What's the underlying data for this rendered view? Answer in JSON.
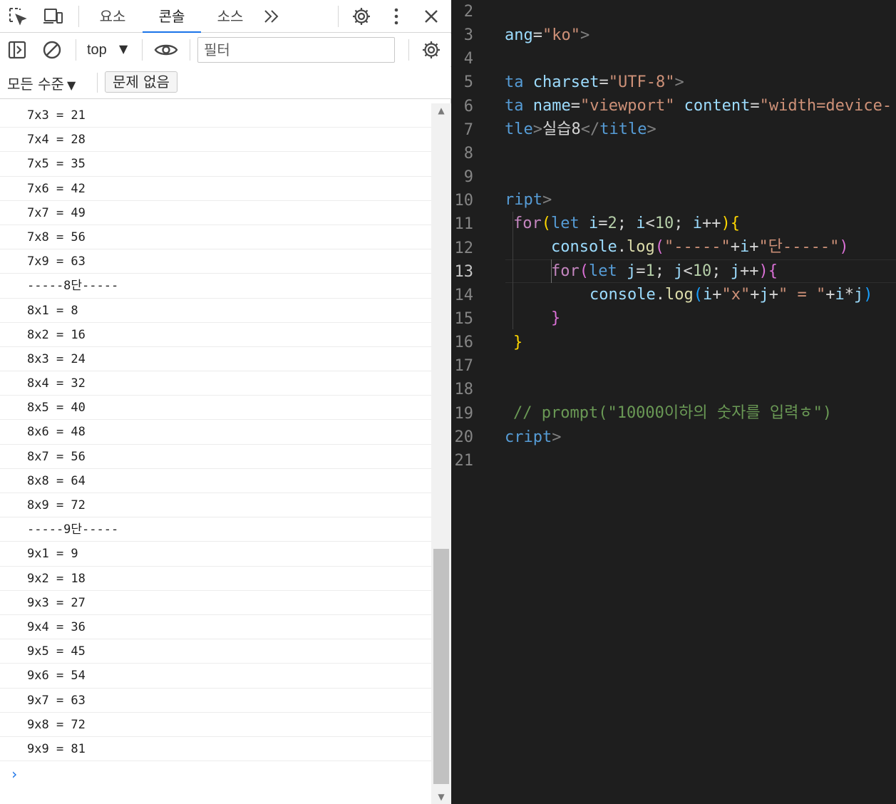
{
  "devtools": {
    "tabs": [
      {
        "label": "요소",
        "active": false
      },
      {
        "label": "콘솔",
        "active": true
      },
      {
        "label": "소스",
        "active": false
      }
    ],
    "toolbar": {
      "context": "top",
      "filter_placeholder": "필터"
    },
    "levels": {
      "label": "모든 수준",
      "issues": "문제 없음"
    },
    "console_lines": [
      "7x3 = 21",
      "7x4 = 28",
      "7x5 = 35",
      "7x6 = 42",
      "7x7 = 49",
      "7x8 = 56",
      "7x9 = 63",
      "-----8단-----",
      "8x1 = 8",
      "8x2 = 16",
      "8x3 = 24",
      "8x4 = 32",
      "8x5 = 40",
      "8x6 = 48",
      "8x7 = 56",
      "8x8 = 64",
      "8x9 = 72",
      "-----9단-----",
      "9x1 = 9",
      "9x2 = 18",
      "9x3 = 27",
      "9x4 = 36",
      "9x5 = 45",
      "9x6 = 54",
      "9x7 = 63",
      "9x8 = 72",
      "9x9 = 81"
    ],
    "prompt_symbol": "›"
  },
  "editor": {
    "current_line": 13,
    "line_numbers": [
      "2",
      "3",
      "4",
      "5",
      "6",
      "7",
      "8",
      "9",
      "10",
      "11",
      "12",
      "13",
      "14",
      "15",
      "16",
      "17",
      "18",
      "19",
      "20",
      "21"
    ],
    "code": {
      "l2_a": "ang",
      "l2_b": "=",
      "l2_c": "\"ko\"",
      "l2_d": ">",
      "l4_a": "ta",
      "l4_b": " charset",
      "l4_c": "=",
      "l4_d": "\"UTF-8\"",
      "l4_e": ">",
      "l5_a": "ta",
      "l5_b": " name",
      "l5_c": "=",
      "l5_d": "\"viewport\"",
      "l5_e": " content",
      "l5_f": "=",
      "l5_g": "\"width=device-",
      "l6_a": "tle",
      "l6_b": ">",
      "l6_c": "실습8",
      "l6_d": "</",
      "l6_e": "title",
      "l6_f": ">",
      "l9_a": "ript",
      "l9_b": ">",
      "l10_a": "for",
      "l10_b": "(",
      "l10_c": "let",
      "l10_d": " i",
      "l10_e": "=",
      "l10_f": "2",
      "l10_g": "; ",
      "l10_h": "i",
      "l10_i": "<",
      "l10_j": "10",
      "l10_k": "; ",
      "l10_l": "i",
      "l10_m": "++",
      "l10_n": ")",
      "l10_o": "{",
      "l11_a": "console",
      "l11_b": ".",
      "l11_c": "log",
      "l11_d": "(",
      "l11_e": "\"-----\"",
      "l11_f": "+",
      "l11_g": "i",
      "l11_h": "+",
      "l11_i": "\"단-----\"",
      "l11_j": ")",
      "l12_a": "for",
      "l12_b": "(",
      "l12_c": "let",
      "l12_d": " j",
      "l12_e": "=",
      "l12_f": "1",
      "l12_g": "; ",
      "l12_h": "j",
      "l12_i": "<",
      "l12_j": "10",
      "l12_k": "; ",
      "l12_l": "j",
      "l12_m": "++",
      "l12_n": ")",
      "l12_o": "{",
      "l13_a": "console",
      "l13_b": ".",
      "l13_c": "log",
      "l13_d": "(",
      "l13_e": "i",
      "l13_f": "+",
      "l13_g": "\"x\"",
      "l13_h": "+",
      "l13_i": "j",
      "l13_j": "+",
      "l13_k": "\" = \"",
      "l13_l": "+",
      "l13_m": "i",
      "l13_n": "*",
      "l13_o": "j",
      "l13_p": ")",
      "l14_a": "}",
      "l15_a": "}",
      "l18_a": "// prompt(\"10000이하의 숫자를 입력ㅎ\")",
      "l19_a": "cript",
      "l19_b": ">"
    }
  },
  "colors": {
    "accent": "#1a73e8",
    "editor_bg": "#1e1e1e",
    "string": "#ce9178",
    "keyword": "#c586c0",
    "comment": "#6a9955"
  }
}
